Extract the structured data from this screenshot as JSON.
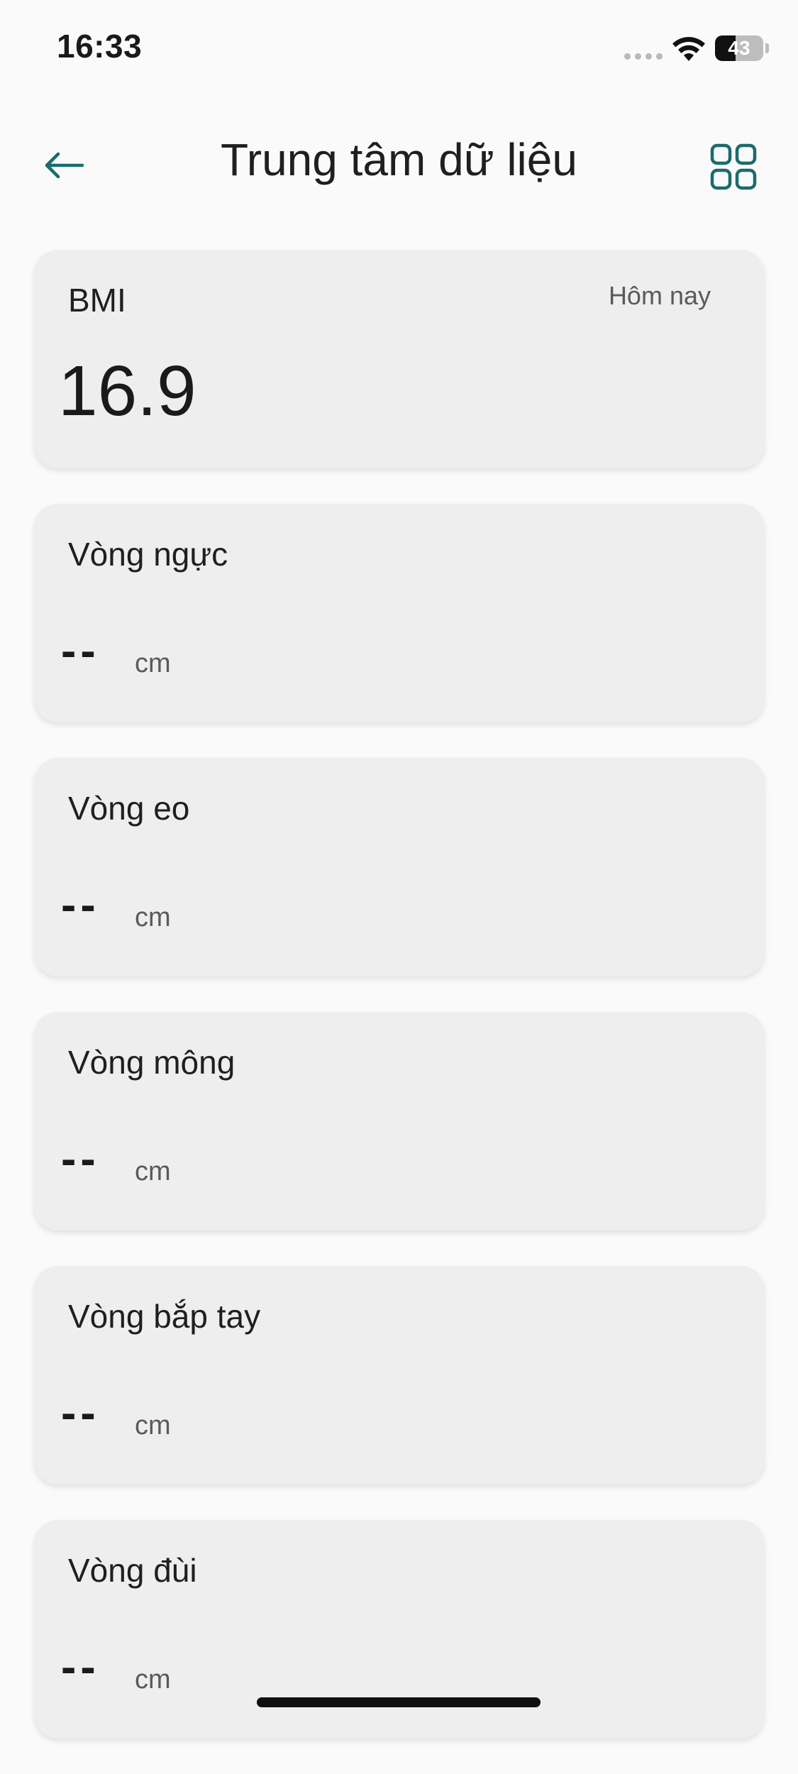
{
  "status_bar": {
    "time": "16:33",
    "battery_level": "43",
    "battery_fraction": 0.43
  },
  "header": {
    "title": "Trung tâm dữ liệu",
    "back_icon": "arrow-left-icon",
    "grid_icon": "grid-icon",
    "accent_color": "#1b6b6b"
  },
  "bmi_card": {
    "label": "BMI",
    "date": "Hôm nay",
    "value": "16.9"
  },
  "measurements": [
    {
      "label": "Vòng ngực",
      "value": "--",
      "unit": "cm"
    },
    {
      "label": "Vòng eo",
      "value": "--",
      "unit": "cm"
    },
    {
      "label": "Vòng mông",
      "value": "--",
      "unit": "cm"
    },
    {
      "label": "Vòng bắp tay",
      "value": "--",
      "unit": "cm"
    },
    {
      "label": "Vòng đùi",
      "value": "--",
      "unit": "cm"
    }
  ]
}
